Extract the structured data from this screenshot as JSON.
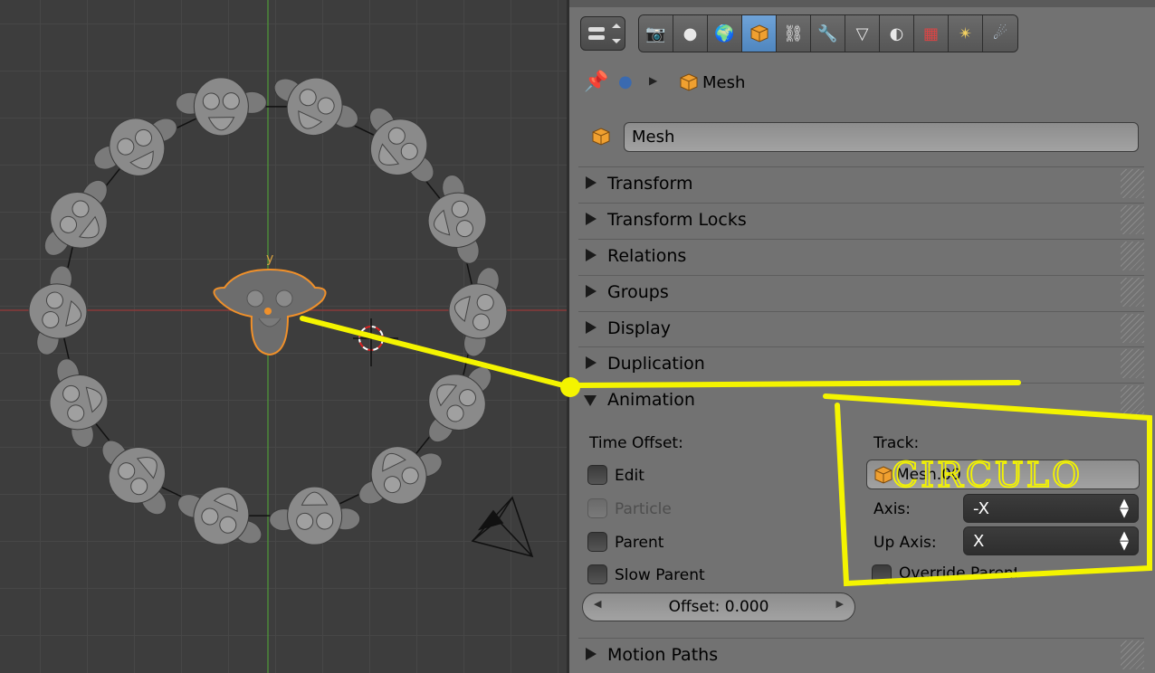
{
  "viewport": {
    "axis_label": "y"
  },
  "properties": {
    "header_tabs": [
      {
        "id": "render",
        "icon": "camera-icon"
      },
      {
        "id": "scene",
        "icon": "scene-icon"
      },
      {
        "id": "world",
        "icon": "world-icon"
      },
      {
        "id": "object",
        "icon": "object-cube-icon",
        "active": true
      },
      {
        "id": "constraints",
        "icon": "link-icon"
      },
      {
        "id": "modifiers",
        "icon": "wrench-icon"
      },
      {
        "id": "data",
        "icon": "mesh-data-icon"
      },
      {
        "id": "material",
        "icon": "material-icon"
      },
      {
        "id": "texture",
        "icon": "texture-icon"
      },
      {
        "id": "particles",
        "icon": "particles-icon"
      },
      {
        "id": "physics",
        "icon": "physics-icon"
      }
    ],
    "breadcrumb": {
      "object": "Mesh"
    },
    "object_name": "Mesh",
    "sections": {
      "transform": "Transform",
      "transform_locks": "Transform Locks",
      "relations": "Relations",
      "groups": "Groups",
      "display": "Display",
      "duplication": "Duplication",
      "animation": "Animation",
      "motion_paths": "Motion Paths"
    },
    "animation": {
      "time_offset_label": "Time Offset:",
      "edit": "Edit",
      "particle": "Particle",
      "parent": "Parent",
      "slow_parent": "Slow Parent",
      "offset": "Offset: 0.000",
      "track_label": "Track:",
      "track_value": "Mesh.00",
      "axis_label": "Axis:",
      "axis_value": "-X",
      "up_axis_label": "Up Axis:",
      "up_axis_value": "X",
      "override_parent": "Override Parent"
    }
  },
  "annotation": {
    "text": "CIRCULO",
    "color": "#f4f400"
  }
}
